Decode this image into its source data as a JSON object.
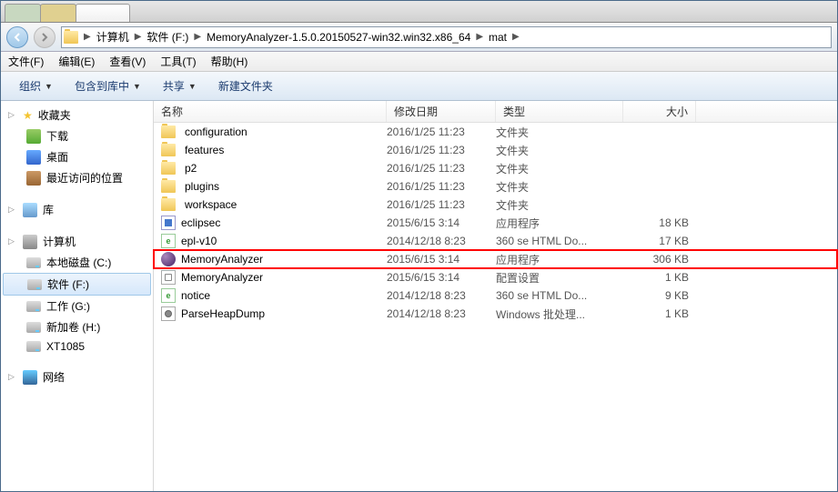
{
  "breadcrumb": {
    "segments": [
      "计算机",
      "软件 (F:)",
      "MemoryAnalyzer-1.5.0.20150527-win32.win32.x86_64",
      "mat"
    ]
  },
  "menus": {
    "file": "文件(F)",
    "edit": "编辑(E)",
    "view": "查看(V)",
    "tools": "工具(T)",
    "help": "帮助(H)"
  },
  "toolbar": {
    "organize": "组织",
    "include": "包含到库中",
    "share": "共享",
    "newfolder": "新建文件夹"
  },
  "sidebar": {
    "favorites": {
      "label": "收藏夹",
      "items": [
        "下载",
        "桌面",
        "最近访问的位置"
      ]
    },
    "libraries": {
      "label": "库"
    },
    "computer": {
      "label": "计算机",
      "drives": [
        "本地磁盘 (C:)",
        "软件 (F:)",
        "工作 (G:)",
        "新加卷 (H:)",
        "XT1085"
      ]
    },
    "network": {
      "label": "网络"
    }
  },
  "columns": {
    "name": "名称",
    "date": "修改日期",
    "type": "类型",
    "size": "大小"
  },
  "files": [
    {
      "icon": "folder",
      "name": "configuration",
      "date": "2016/1/25 11:23",
      "type": "文件夹",
      "size": ""
    },
    {
      "icon": "folder",
      "name": "features",
      "date": "2016/1/25 11:23",
      "type": "文件夹",
      "size": ""
    },
    {
      "icon": "folder",
      "name": "p2",
      "date": "2016/1/25 11:23",
      "type": "文件夹",
      "size": ""
    },
    {
      "icon": "folder",
      "name": "plugins",
      "date": "2016/1/25 11:23",
      "type": "文件夹",
      "size": ""
    },
    {
      "icon": "folder",
      "name": "workspace",
      "date": "2016/1/25 11:23",
      "type": "文件夹",
      "size": ""
    },
    {
      "icon": "exe",
      "name": "eclipsec",
      "date": "2015/6/15 3:14",
      "type": "应用程序",
      "size": "18 KB"
    },
    {
      "icon": "html",
      "name": "epl-v10",
      "date": "2014/12/18 8:23",
      "type": "360 se HTML Do...",
      "size": "17 KB"
    },
    {
      "icon": "eclipse",
      "name": "MemoryAnalyzer",
      "date": "2015/6/15 3:14",
      "type": "应用程序",
      "size": "306 KB",
      "highlighted": true
    },
    {
      "icon": "ini",
      "name": "MemoryAnalyzer",
      "date": "2015/6/15 3:14",
      "type": "配置设置",
      "size": "1 KB"
    },
    {
      "icon": "html",
      "name": "notice",
      "date": "2014/12/18 8:23",
      "type": "360 se HTML Do...",
      "size": "9 KB"
    },
    {
      "icon": "bat",
      "name": "ParseHeapDump",
      "date": "2014/12/18 8:23",
      "type": "Windows 批处理...",
      "size": "1 KB"
    }
  ]
}
